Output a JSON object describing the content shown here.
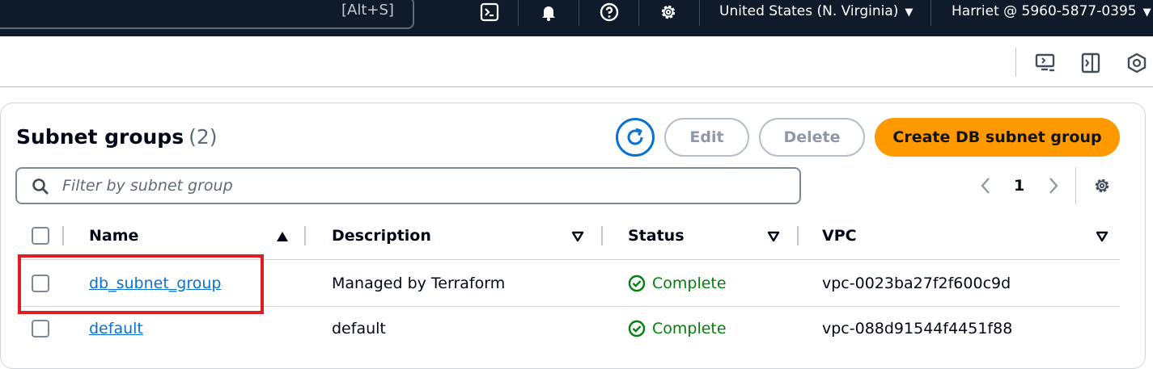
{
  "topbar": {
    "search_shortcut": "[Alt+S]",
    "icons": [
      "cloudshell-icon",
      "bell-icon",
      "help-icon",
      "gear-icon"
    ],
    "region": "United States (N. Virginia)",
    "account": "Harriet @ 5960-5877-0395"
  },
  "toolbar": {
    "icons": [
      "monitor-icon",
      "panel-icon",
      "hexagon-icon"
    ]
  },
  "header": {
    "title": "Subnet groups",
    "count": "(2)",
    "edit_label": "Edit",
    "delete_label": "Delete",
    "create_label": "Create DB subnet group"
  },
  "filter": {
    "placeholder": "Filter by subnet group",
    "value": ""
  },
  "pagination": {
    "current_page": "1"
  },
  "table": {
    "columns": [
      "Name",
      "Description",
      "Status",
      "VPC"
    ],
    "rows": [
      {
        "name": "db_subnet_group",
        "description": "Managed by Terraform",
        "status": "Complete",
        "vpc": "vpc-0023ba27f2f600c9d"
      },
      {
        "name": "default",
        "description": "default",
        "status": "Complete",
        "vpc": "vpc-088d91544f4451f88"
      }
    ]
  },
  "colors": {
    "nav_bg": "#0f1b2a",
    "primary": "#ff9900",
    "link": "#0972d3",
    "success": "#037f0c",
    "highlight": "#dd1e25"
  }
}
